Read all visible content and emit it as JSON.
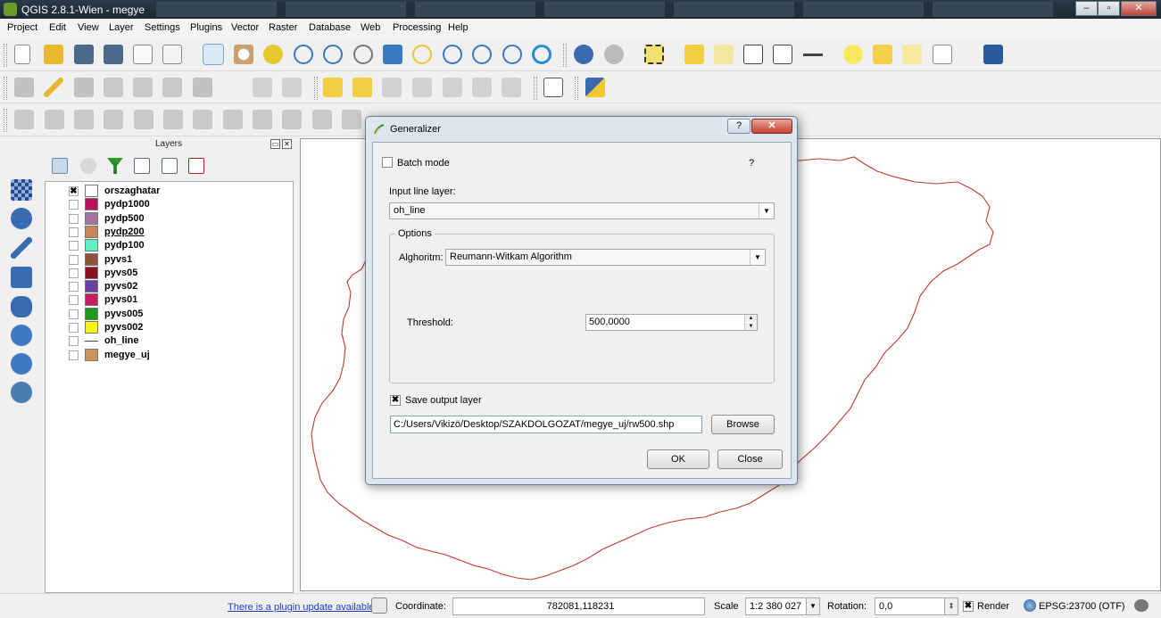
{
  "window": {
    "title": "QGIS 2.8.1-Wien - megye"
  },
  "menu": [
    "Project",
    "Edit",
    "View",
    "Layer",
    "Settings",
    "Plugins",
    "Vector",
    "Raster",
    "Database",
    "Web",
    "Processing",
    "Help"
  ],
  "layers_panel": {
    "title": "Layers",
    "items": [
      {
        "name": "orszaghatar",
        "checked": true,
        "color": "#ffffff",
        "underline": false
      },
      {
        "name": "pydp1000",
        "checked": false,
        "color": "#b5155a",
        "underline": false
      },
      {
        "name": "pydp500",
        "checked": false,
        "color": "#a474a0",
        "underline": false
      },
      {
        "name": "pydp200",
        "checked": false,
        "color": "#c8865a",
        "underline": true
      },
      {
        "name": "pydp100",
        "checked": false,
        "color": "#5ff0c4",
        "underline": false
      },
      {
        "name": "pyvs1",
        "checked": false,
        "color": "#8c5438",
        "underline": false
      },
      {
        "name": "pyvs05",
        "checked": false,
        "color": "#8a1022",
        "underline": false
      },
      {
        "name": "pyvs02",
        "checked": false,
        "color": "#6a40a0",
        "underline": false
      },
      {
        "name": "pyvs01",
        "checked": false,
        "color": "#c21e62",
        "underline": false
      },
      {
        "name": "pyvs005",
        "checked": false,
        "color": "#1e9a1e",
        "underline": false
      },
      {
        "name": "pyvs002",
        "checked": false,
        "color": "#f4f41a",
        "underline": false
      },
      {
        "name": "oh_line",
        "checked": false,
        "color": "line",
        "underline": false
      },
      {
        "name": "megye_uj",
        "checked": false,
        "color": "#c8965a",
        "underline": false
      }
    ]
  },
  "dialog": {
    "title": "Generalizer",
    "help_btn": "?",
    "close_btn": "✕",
    "batch_mode": "Batch mode",
    "help_mark": "?",
    "input_label": "Input line layer:",
    "input_value": "oh_line",
    "options_title": "Options",
    "algorithm_label": "Alghoritm:",
    "algorithm_value": "Reumann-Witkam Algorithm",
    "threshold_label": "Threshold:",
    "threshold_value": "500,0000",
    "save_label": "Save output layer",
    "save_checked": true,
    "path_value": "C:/Users/Vikizö/Desktop/SZAKDOLGOZAT/megye_uj/rw500.shp",
    "browse": "Browse",
    "ok": "OK",
    "close": "Close"
  },
  "status": {
    "plugin_link": "There is a plugin update available",
    "coordinate_label": "Coordinate:",
    "coordinate_value": "782081,118231",
    "scale_label": "Scale",
    "scale_value": "1:2 380 027",
    "rotation_label": "Rotation:",
    "rotation_value": "0,0",
    "render_label": "Render",
    "epsg": "EPSG:23700 (OTF)"
  },
  "colors": {
    "boundary": "#c0392b",
    "accent": "#2a6ab8"
  }
}
